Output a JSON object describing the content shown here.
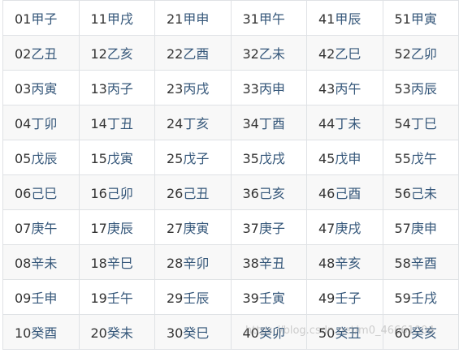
{
  "table": {
    "rows": [
      [
        {
          "num": "01",
          "gz": "甲子"
        },
        {
          "num": "11",
          "gz": "甲戌"
        },
        {
          "num": "21",
          "gz": "甲申"
        },
        {
          "num": "31",
          "gz": "甲午"
        },
        {
          "num": "41",
          "gz": "甲辰"
        },
        {
          "num": "51",
          "gz": "甲寅"
        }
      ],
      [
        {
          "num": "02",
          "gz": "乙丑"
        },
        {
          "num": "12",
          "gz": "乙亥"
        },
        {
          "num": "22",
          "gz": "乙酉"
        },
        {
          "num": "32",
          "gz": "乙未"
        },
        {
          "num": "42",
          "gz": "乙巳"
        },
        {
          "num": "52",
          "gz": "乙卯"
        }
      ],
      [
        {
          "num": "03",
          "gz": "丙寅"
        },
        {
          "num": "13",
          "gz": "丙子"
        },
        {
          "num": "23",
          "gz": "丙戌"
        },
        {
          "num": "33",
          "gz": "丙申"
        },
        {
          "num": "43",
          "gz": "丙午"
        },
        {
          "num": "53",
          "gz": "丙辰"
        }
      ],
      [
        {
          "num": "04",
          "gz": "丁卯"
        },
        {
          "num": "14",
          "gz": "丁丑"
        },
        {
          "num": "24",
          "gz": "丁亥"
        },
        {
          "num": "34",
          "gz": "丁酉"
        },
        {
          "num": "44",
          "gz": "丁未"
        },
        {
          "num": "54",
          "gz": "丁巳"
        }
      ],
      [
        {
          "num": "05",
          "gz": "戊辰"
        },
        {
          "num": "15",
          "gz": "戊寅"
        },
        {
          "num": "25",
          "gz": "戊子"
        },
        {
          "num": "35",
          "gz": "戊戌"
        },
        {
          "num": "45",
          "gz": "戊申"
        },
        {
          "num": "55",
          "gz": "戊午"
        }
      ],
      [
        {
          "num": "06",
          "gz": "己巳"
        },
        {
          "num": "16",
          "gz": "己卯"
        },
        {
          "num": "26",
          "gz": "己丑"
        },
        {
          "num": "36",
          "gz": "己亥"
        },
        {
          "num": "46",
          "gz": "己酉"
        },
        {
          "num": "56",
          "gz": "己未"
        }
      ],
      [
        {
          "num": "07",
          "gz": "庚午"
        },
        {
          "num": "17",
          "gz": "庚辰"
        },
        {
          "num": "27",
          "gz": "庚寅"
        },
        {
          "num": "37",
          "gz": "庚子"
        },
        {
          "num": "47",
          "gz": "庚戌"
        },
        {
          "num": "57",
          "gz": "庚申"
        }
      ],
      [
        {
          "num": "08",
          "gz": "辛未"
        },
        {
          "num": "18",
          "gz": "辛巳"
        },
        {
          "num": "28",
          "gz": "辛卯"
        },
        {
          "num": "38",
          "gz": "辛丑"
        },
        {
          "num": "48",
          "gz": "辛亥"
        },
        {
          "num": "58",
          "gz": "辛酉"
        }
      ],
      [
        {
          "num": "09",
          "gz": "壬申"
        },
        {
          "num": "19",
          "gz": "壬午"
        },
        {
          "num": "29",
          "gz": "壬辰"
        },
        {
          "num": "39",
          "gz": "壬寅"
        },
        {
          "num": "49",
          "gz": "壬子"
        },
        {
          "num": "59",
          "gz": "壬戌"
        }
      ],
      [
        {
          "num": "10",
          "gz": "癸酉"
        },
        {
          "num": "20",
          "gz": "癸未"
        },
        {
          "num": "30",
          "gz": "癸巳"
        },
        {
          "num": "40",
          "gz": "癸卯"
        },
        {
          "num": "50",
          "gz": "癸丑"
        },
        {
          "num": "60",
          "gz": "癸亥"
        }
      ]
    ]
  },
  "watermark": "https://blog.csdn.net/m0_46661004",
  "colors": {
    "number_text": "#333333",
    "ganzhi_text": "#35577a",
    "border": "#dfe2e5",
    "alt_row_bg": "#f8f8f8"
  }
}
